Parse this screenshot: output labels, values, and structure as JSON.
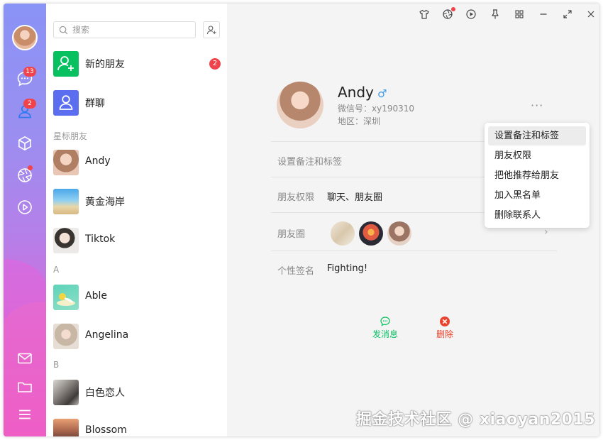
{
  "search": {
    "placeholder": "搜索"
  },
  "rail": {
    "chat_badge": "13",
    "contacts_badge": "2"
  },
  "contacts": {
    "new_friends": {
      "label": "新的朋友",
      "badge": "2"
    },
    "group_chat": {
      "label": "群聊"
    },
    "sections": {
      "starred": "星标朋友",
      "a": "A",
      "b": "B"
    },
    "starred": [
      {
        "name": "Andy"
      },
      {
        "name": "黄金海岸"
      },
      {
        "name": "Tiktok"
      }
    ],
    "a_list": [
      {
        "name": "Able"
      },
      {
        "name": "Angelina"
      }
    ],
    "b_list": [
      {
        "name": "白色恋人"
      },
      {
        "name": "Blossom"
      }
    ]
  },
  "profile": {
    "name": "Andy",
    "gender_symbol": "♂",
    "wechat_id": "微信号：xy190310",
    "region": "地区：深圳",
    "more": "···"
  },
  "fields": {
    "remark_label": "设置备注和标签",
    "permission_label": "朋友权限",
    "permission_value": "聊天、朋友圈",
    "moments_label": "朋友圈",
    "signature_label": "个性签名",
    "signature_value": "Fighting!"
  },
  "actions": {
    "message": "发消息",
    "delete": "删除"
  },
  "menu": [
    {
      "label": "设置备注和标签"
    },
    {
      "label": "朋友权限"
    },
    {
      "label": "把他推荐给朋友"
    },
    {
      "label": "加入黑名单"
    },
    {
      "label": "删除联系人"
    }
  ],
  "watermark": "掘金技术社区 @ xiaoyan2015",
  "colors": {
    "accent_green": "#07c160",
    "badge_red": "#f0444a",
    "delete_red": "#e8432f",
    "gender_blue": "#3d9be9"
  }
}
